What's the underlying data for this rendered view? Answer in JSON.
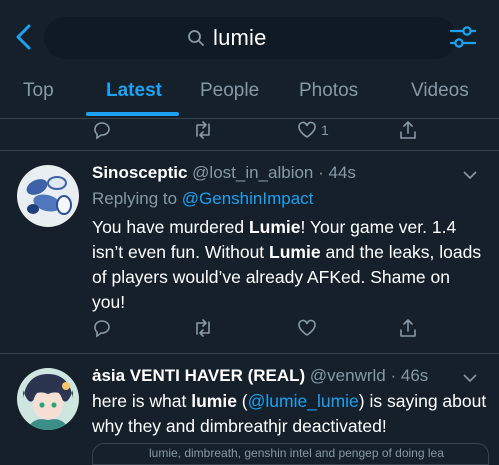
{
  "search": {
    "query": "lumie"
  },
  "tabs": [
    {
      "label": "Top"
    },
    {
      "label": "Latest"
    },
    {
      "label": "People"
    },
    {
      "label": "Photos"
    },
    {
      "label": "Videos"
    }
  ],
  "prev_tweet_actions": {
    "like_count": "1"
  },
  "tweets": [
    {
      "name": "Sinosceptic",
      "handle": "@lost_in_albion",
      "sep": " · ",
      "time": "44s",
      "reply_prefix": "Replying to ",
      "reply_to": "@GenshinImpact",
      "body": [
        "You have murdered ",
        "Lumie",
        "! Your game ver. 1.4 isn’t even fun. Without ",
        "Lumie",
        " and the leaks, loads of players would’ve already AFKed. Shame on you!"
      ]
    },
    {
      "name": "ȧsia VENTI HAVER (REAL)",
      "handle": "@venwrld",
      "sep": " · ",
      "time": "46s",
      "body": [
        "here is what ",
        "lumie",
        " (",
        "@lumie_lumie",
        ") is saying about why they and dimbreathjr deactivated!"
      ],
      "card_preview": "lumie, dimbreath, genshin intel and pengep of doing lea"
    }
  ],
  "colors": {
    "accent": "#1da1f2",
    "background": "#15202b",
    "muted": "#8899a6",
    "divider": "#38444d"
  }
}
